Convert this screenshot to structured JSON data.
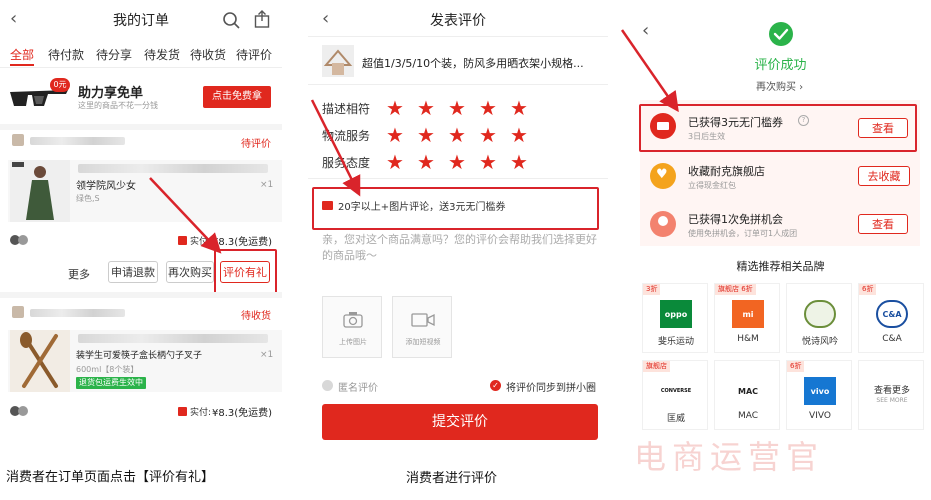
{
  "orders": {
    "title": "我的订单",
    "tabs": [
      "全部",
      "待付款",
      "待分享",
      "待发货",
      "待收货",
      "待评价"
    ],
    "promo": {
      "badge": "0元",
      "title": "助力享免单",
      "subtitle": "这里的商品不花一分钱",
      "button": "点击免费拿"
    },
    "order1": {
      "status": "待评价",
      "product_name": "领学院风少女",
      "spec": "绿色,S",
      "qty": "×1",
      "paid_label": "实付:",
      "paid_value": "¥8.3(免运费)",
      "actions": [
        "更多",
        "申请退款",
        "再次购买",
        "评价有礼"
      ]
    },
    "order2": {
      "status": "待收货",
      "product_name": "装学生可爱筷子盒长柄勺子叉子",
      "spec": "600ml【8个装】",
      "qty": "×1",
      "tag": "退货包运费生效中",
      "paid_label": "实付:",
      "paid_value": "¥8.3(免运费)"
    },
    "caption": "消费者在订单页面点击【评价有礼】"
  },
  "review": {
    "title": "发表评价",
    "product_name": "超值1/3/5/10个装，防风多用晒衣架小规格...",
    "ratings": [
      {
        "label": "描述相符",
        "stars": 5
      },
      {
        "label": "物流服务",
        "stars": 5
      },
      {
        "label": "服务态度",
        "stars": 5
      }
    ],
    "reward_tip": "20字以上+图片评论，送3元无门槛券",
    "placeholder": "亲，您对这个商品满意吗？您的评价会帮助我们选择更好的商品哦～",
    "upload_image": "上传图片",
    "add_video": "添加短视频",
    "anonymous": "匿名评价",
    "sync": "将评价同步到拼小圈",
    "submit": "提交评价",
    "caption": "消费者进行评价"
  },
  "success": {
    "title": "评价成功",
    "buy_again": "再次购买",
    "rewards": [
      {
        "title": "已获得3元无门槛券",
        "sub": "3日后生效",
        "button": "查看"
      },
      {
        "title": "收藏耐克旗舰店",
        "sub": "立得现金红包",
        "button": "去收藏"
      },
      {
        "title": "已获得1次免拼机会",
        "sub": "使用免拼机会，订单可1人成团",
        "button": "查看"
      }
    ],
    "brands_title": "精选推荐相关品牌",
    "brands": [
      {
        "tag": "3折",
        "logo": "oppo",
        "name": "斐乐运动",
        "color": "#0a8a3a"
      },
      {
        "tag": "旗舰店 6折",
        "logo": "mi",
        "name": "H&M",
        "color": "#f26522"
      },
      {
        "tag": "",
        "logo": "",
        "name": "悦诗风吟",
        "color": "#6b8e3a"
      },
      {
        "tag": "6折",
        "logo": "C&A",
        "name": "C&A",
        "color": "#1a4fa0"
      },
      {
        "tag": "旗舰店",
        "logo": "CONVERSE",
        "name": "匡威",
        "color": "#111111"
      },
      {
        "tag": "",
        "logo": "MAC",
        "name": "MAC",
        "color": "#222222"
      },
      {
        "tag": "6折",
        "logo": "vivo",
        "name": "VIVO",
        "color": "#1677d2"
      },
      {
        "tag": "",
        "logo": "",
        "name": "查看更多",
        "sub": "SEE MORE",
        "color": "#333333"
      }
    ]
  },
  "watermark": "电商运营官",
  "colors": {
    "accent": "#e0281e",
    "success": "#2bb34a",
    "coupon_bg": "#fff5f3"
  }
}
